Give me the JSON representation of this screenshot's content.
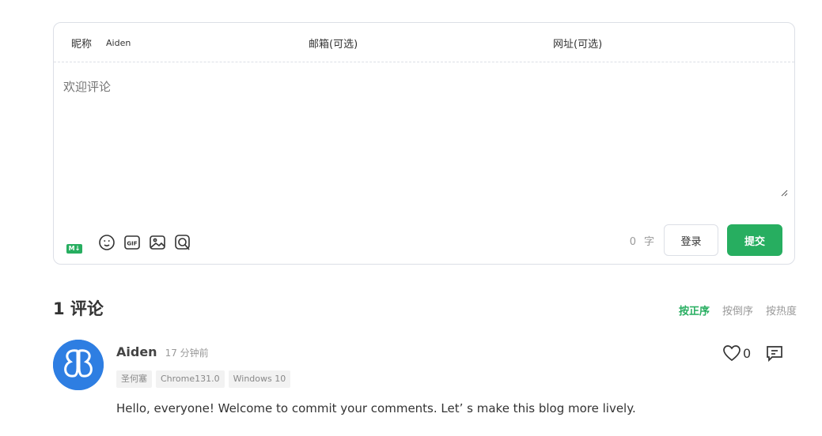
{
  "editor": {
    "nick_label": "昵称",
    "nick_value": "Aiden",
    "mail_label": "邮箱(可选)",
    "url_label": "网址(可选)",
    "textarea_placeholder": "欢迎评论",
    "markdown_badge": "M↓",
    "word_count": "0",
    "word_unit": "字",
    "login_label": "登录",
    "submit_label": "提交",
    "tools": [
      "emoji-icon",
      "gif-icon",
      "image-icon",
      "preview-icon"
    ]
  },
  "comments_header": {
    "count_title": "1 评论",
    "sort_options": [
      "按正序",
      "按倒序",
      "按热度"
    ],
    "active_sort": "按正序"
  },
  "comment": {
    "nick": "Aiden",
    "time": "17 分钟前",
    "tags": [
      "圣何塞",
      "Chrome131.0",
      "Windows 10"
    ],
    "content": "Hello, everyone! Welcome to commit your comments. Let’ s make this blog more lively.",
    "likes": "0"
  },
  "colors": {
    "accent": "#27ae60",
    "avatar": "#2e7ee2"
  }
}
